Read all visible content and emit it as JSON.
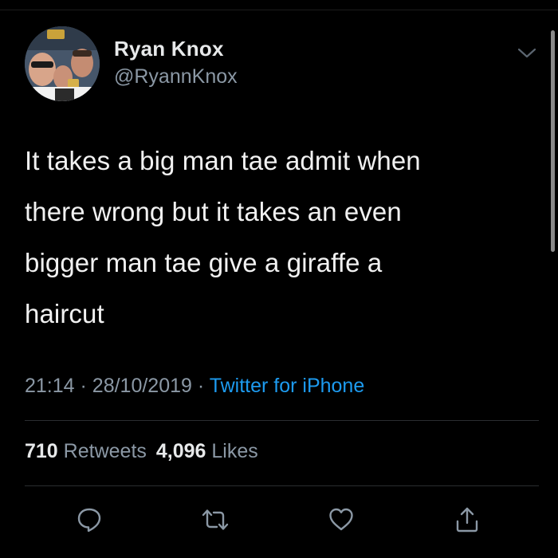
{
  "tweet": {
    "display_name": "Ryan Knox",
    "handle": "@RyannKnox",
    "text": "It takes a big man tae admit when\nthere wrong but it takes an even\nbigger man tae give a giraffe a\nhaircut",
    "time": "21:14",
    "separator": "·",
    "date": "28/10/2019",
    "source": "Twitter for iPhone"
  },
  "stats": {
    "retweets_count": "710",
    "retweets_label": "Retweets",
    "likes_count": "4,096",
    "likes_label": "Likes"
  },
  "icons": {
    "menu": "chevron-down-icon",
    "reply": "reply-icon",
    "retweet": "retweet-icon",
    "like": "heart-icon",
    "share": "share-icon"
  },
  "colors": {
    "background": "#000000",
    "text": "#f1f1f1",
    "secondary_text": "#8b98a5",
    "link": "#1d9bf0",
    "divider": "#2a2d30"
  }
}
